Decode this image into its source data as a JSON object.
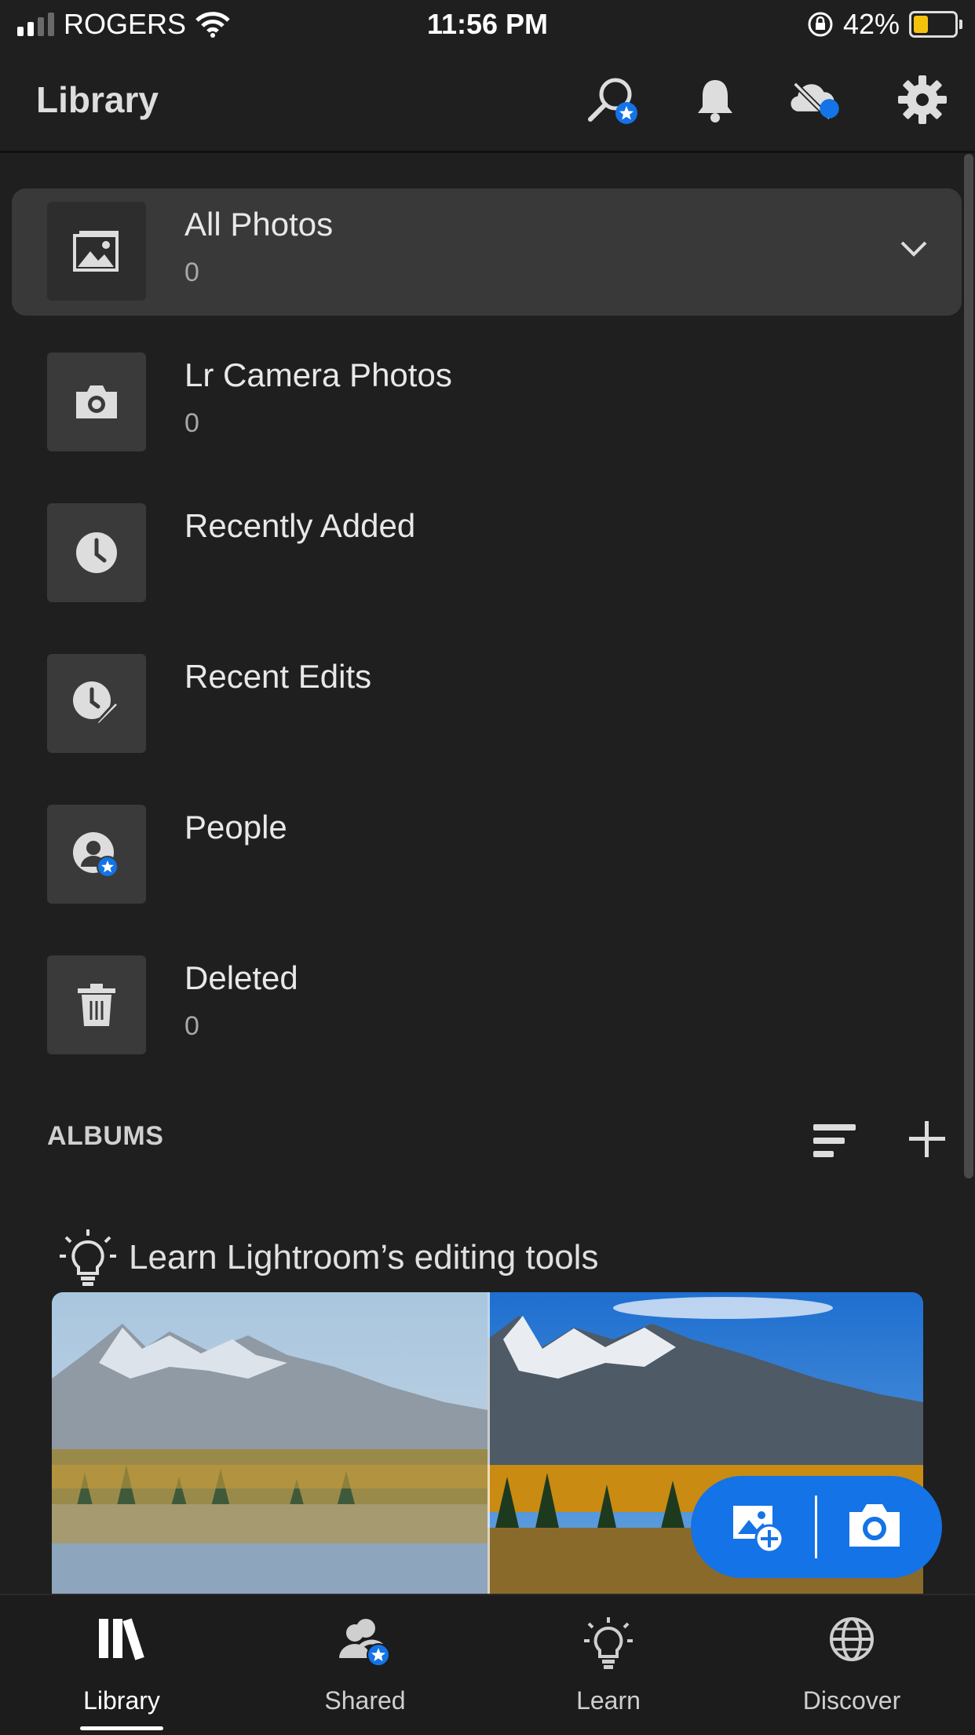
{
  "status_bar": {
    "carrier": "ROGERS",
    "time": "11:56 PM",
    "battery_percent": "42%",
    "battery_level": 0.42,
    "signal_bars": 2
  },
  "header": {
    "title": "Library",
    "icons": [
      "search-icon",
      "bell-icon",
      "cloud-off-icon",
      "gear-icon"
    ]
  },
  "library_items": [
    {
      "label": "All Photos",
      "count": "0",
      "icon": "photo-icon",
      "selected": true
    },
    {
      "label": "Lr Camera Photos",
      "count": "0",
      "icon": "camera-icon"
    },
    {
      "label": "Recently Added",
      "count": "",
      "icon": "clock-icon"
    },
    {
      "label": "Recent Edits",
      "count": "",
      "icon": "clock-edit-icon"
    },
    {
      "label": "People",
      "count": "",
      "icon": "person-icon"
    },
    {
      "label": "Deleted",
      "count": "0",
      "icon": "trash-icon"
    }
  ],
  "albums": {
    "heading": "ALBUMS"
  },
  "learn_banner": {
    "title": "Learn Lightroom’s editing tools"
  },
  "tabs": [
    {
      "label": "Library",
      "icon": "library-icon",
      "active": true
    },
    {
      "label": "Shared",
      "icon": "shared-icon"
    },
    {
      "label": "Learn",
      "icon": "lightbulb-icon"
    },
    {
      "label": "Discover",
      "icon": "globe-icon"
    }
  ],
  "colors": {
    "accent": "#1473e6",
    "background": "#1f1f1f",
    "selected_row": "#393939"
  }
}
